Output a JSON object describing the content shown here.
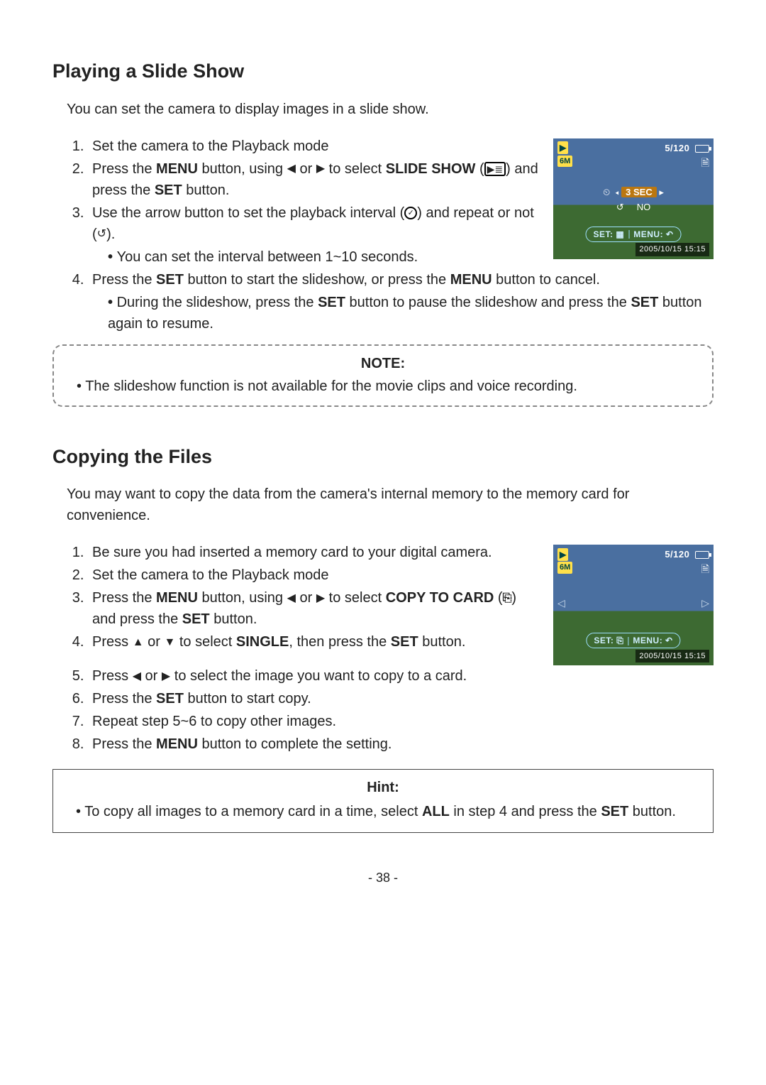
{
  "page_number": "- 38 -",
  "section1": {
    "title": "Playing a Slide Show",
    "intro": "You can set the camera to display images in a slide show.",
    "steps": {
      "s1": "Set the camera to the Playback mode",
      "s2a": "Press the ",
      "s2_menu": "MENU",
      "s2b": " button, using ",
      "s2c": " or ",
      "s2d": " to select ",
      "s2_slide": "SLIDE SHOW",
      "s2e": " (",
      "s2f": ") and press the ",
      "s2_set": "SET",
      "s2g": " button.",
      "s3a": "Use the arrow button to set the playback interval (",
      "s3b": ") and repeat or not (",
      "s3c": ").",
      "s3sub": "You can set the interval between 1~10 seconds.",
      "s4a": "Press the ",
      "s4_set": "SET",
      "s4b": " button to start the slideshow, or press the ",
      "s4_menu": "MENU",
      "s4c": " button to cancel.",
      "s4sub_a": "During the slideshow, press the ",
      "s4sub_set1": "SET",
      "s4sub_b": " button to pause the slideshow and press the ",
      "s4sub_set2": "SET",
      "s4sub_c": " button again to resume."
    },
    "note_title": "NOTE:",
    "note_item": "The slideshow function is not available for the movie clips and voice recording.",
    "lcd": {
      "counter": "5/120",
      "badge6m": "6M",
      "interval_label": "3 SEC",
      "repeat_label": "NO",
      "pill_set": "SET:",
      "pill_menu": "MENU:",
      "timestamp": "2005/10/15  15:15"
    }
  },
  "section2": {
    "title": "Copying the Files",
    "intro": "You may want to copy the data from the camera's internal memory to the memory card for convenience.",
    "steps": {
      "s1": "Be sure you had inserted a memory card to your digital camera.",
      "s2": "Set the camera to the Playback mode",
      "s3a": "Press the ",
      "s3_menu": "MENU",
      "s3b": " button, using ",
      "s3c": " or ",
      "s3d": " to select ",
      "s3_copy": "COPY TO CARD",
      "s3e": " (",
      "s3f": ") and press the ",
      "s3_set": "SET",
      "s3g": " button.",
      "s4a": "Press ",
      "s4b": " or ",
      "s4c": " to select ",
      "s4_single": "SINGLE",
      "s4d": ", then press the ",
      "s4_set": "SET",
      "s4e": " button.",
      "s5a": "Press ",
      "s5b": " or ",
      "s5c": " to select the image you want to copy to a card.",
      "s6a": "Press the ",
      "s6_set": "SET",
      "s6b": " button to start copy.",
      "s7": "Repeat step 5~6 to copy other images.",
      "s8a": "Press the ",
      "s8_menu": "MENU",
      "s8b": " button to complete the setting."
    },
    "hint_title": "Hint:",
    "hint_a": "To copy all images to a memory card in a time, select ",
    "hint_all": "ALL",
    "hint_b": " in step 4 and press the ",
    "hint_set": "SET",
    "hint_c": " button.",
    "lcd": {
      "counter": "5/120",
      "badge6m": "6M",
      "pill_set": "SET:",
      "pill_menu": "MENU:",
      "timestamp": "2005/10/15  15:15"
    }
  }
}
